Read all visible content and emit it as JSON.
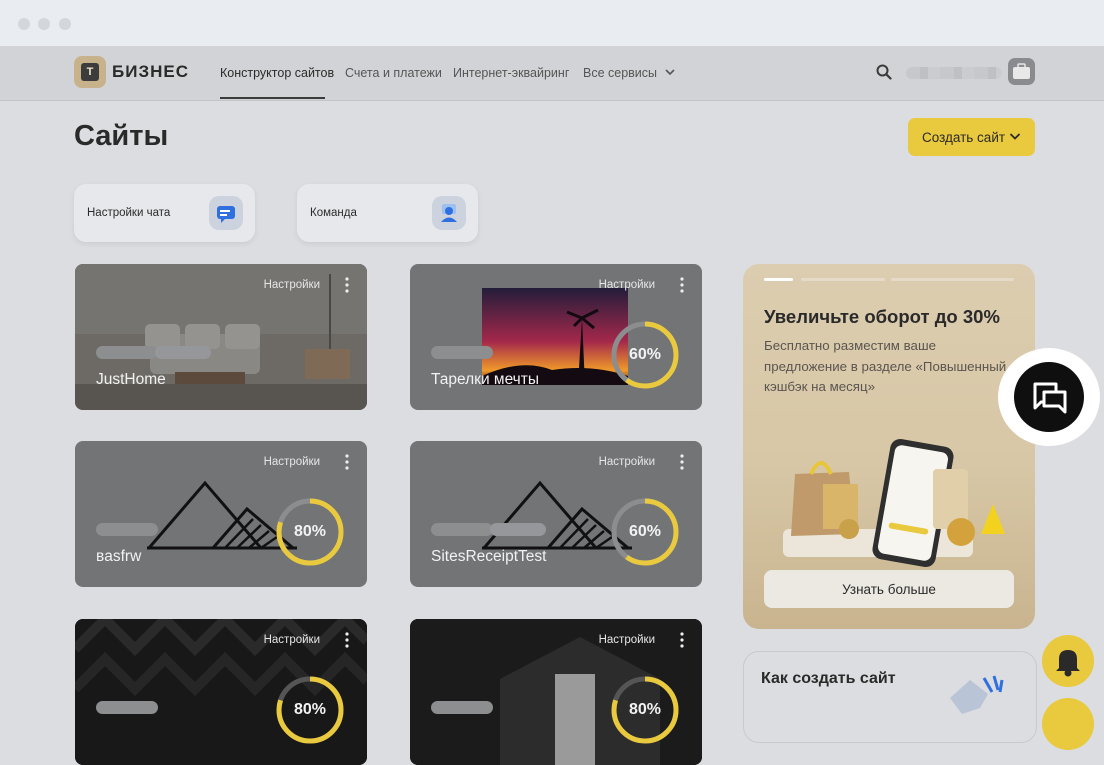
{
  "header": {
    "brand": "БИЗНЕС",
    "logo_letter": "Т",
    "nav": [
      "Конструктор сайтов",
      "Счета и платежи",
      "Интернет-эквайринг",
      "Все сервисы"
    ]
  },
  "page": {
    "title": "Сайты",
    "create_button": "Создать сайт"
  },
  "quick_actions": [
    {
      "label": "Настройки чата",
      "icon": "chat-settings-icon"
    },
    {
      "label": "Команда",
      "icon": "team-icon"
    }
  ],
  "sites": [
    {
      "name": "JustHome",
      "settings": "Настройки",
      "progress": null,
      "cover": "photo-interior"
    },
    {
      "name": "Тарелки мечты",
      "settings": "Настройки",
      "progress": "60%",
      "cover": "photo-sunset"
    },
    {
      "name": "вasfrw",
      "settings": "Настройки",
      "progress": "80%",
      "cover": "placeholder-mountains"
    },
    {
      "name": "SitesReceiptTest",
      "settings": "Настройки",
      "progress": "60%",
      "cover": "placeholder-mountains"
    },
    {
      "name": "",
      "settings": "Настройки",
      "progress": "80%",
      "cover": "dark-pattern"
    },
    {
      "name": "",
      "settings": "Настройки",
      "progress": "80%",
      "cover": "dark-photo"
    }
  ],
  "promo": {
    "title": "Увеличьте оборот до 30%",
    "text": "Бесплатно разместим ваше предложение в разделе «Повышенный кэшбэк на месяц»",
    "button": "Узнать больше"
  },
  "how_to": {
    "title": "Как создать сайт"
  },
  "colors": {
    "accent": "#e9c93d",
    "background": "#dcdde1"
  }
}
